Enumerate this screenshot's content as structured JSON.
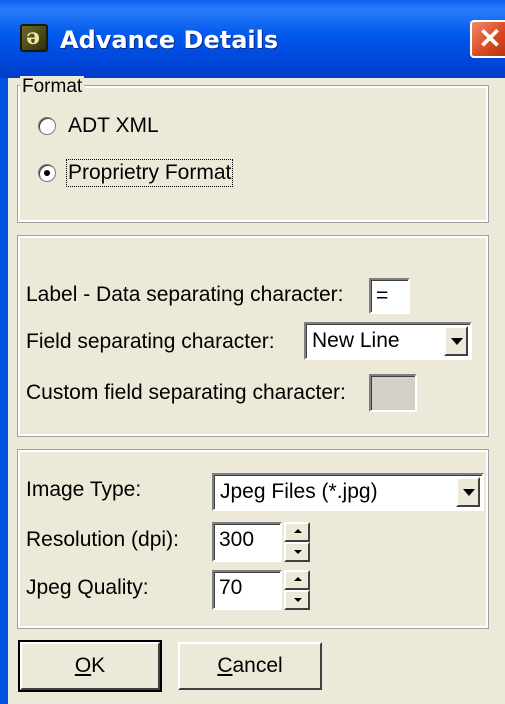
{
  "window": {
    "title": "Advance Details",
    "icon": "app-icon",
    "close_icon": "close-icon"
  },
  "format": {
    "legend": "Format",
    "options": [
      {
        "label": "ADT XML",
        "checked": false
      },
      {
        "label": "Proprietry Format",
        "checked": true
      }
    ]
  },
  "separators": {
    "label_data_label": "Label - Data separating character:",
    "label_data_value": "=",
    "field_sep_label": "Field separating character:",
    "field_sep_value": "New Line",
    "custom_field_label": "Custom field separating character:",
    "custom_field_value": ""
  },
  "image": {
    "type_label": "Image Type:",
    "type_value": "Jpeg Files (*.jpg)",
    "resolution_label": "Resolution (dpi):",
    "resolution_value": "300",
    "quality_label": "Jpeg Quality:",
    "quality_value": "70"
  },
  "buttons": {
    "ok": "OK",
    "cancel": "Cancel"
  }
}
